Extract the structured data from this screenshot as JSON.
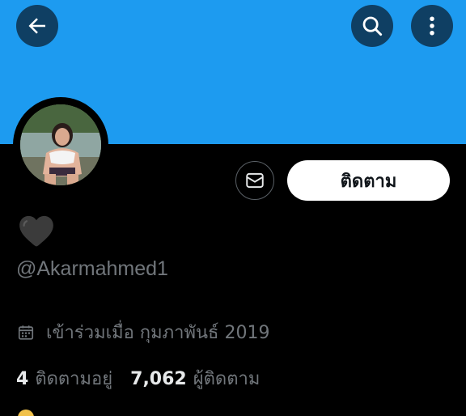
{
  "colors": {
    "banner": "#1d9bf0",
    "background": "#000000",
    "icon_button_bg": "#0f3f63",
    "muted_text": "#71767b",
    "heart": "#3b3b3b"
  },
  "header": {
    "back_icon": "arrow-left-icon",
    "search_icon": "search-icon",
    "more_icon": "more-vertical-icon"
  },
  "profile": {
    "display_name_emoji": "black-heart",
    "handle": "@Akarmahmed1",
    "joined": "เข้าร่วมเมื่อ กุมภาพันธ์ 2019",
    "follow_label": "ติดตาม",
    "message_icon": "envelope-icon",
    "calendar_icon": "calendar-icon"
  },
  "stats": {
    "following_count": "4",
    "following_label": "ติดตามอยู่",
    "followers_count": "7,062",
    "followers_label": "ผู้ติดตาม"
  }
}
